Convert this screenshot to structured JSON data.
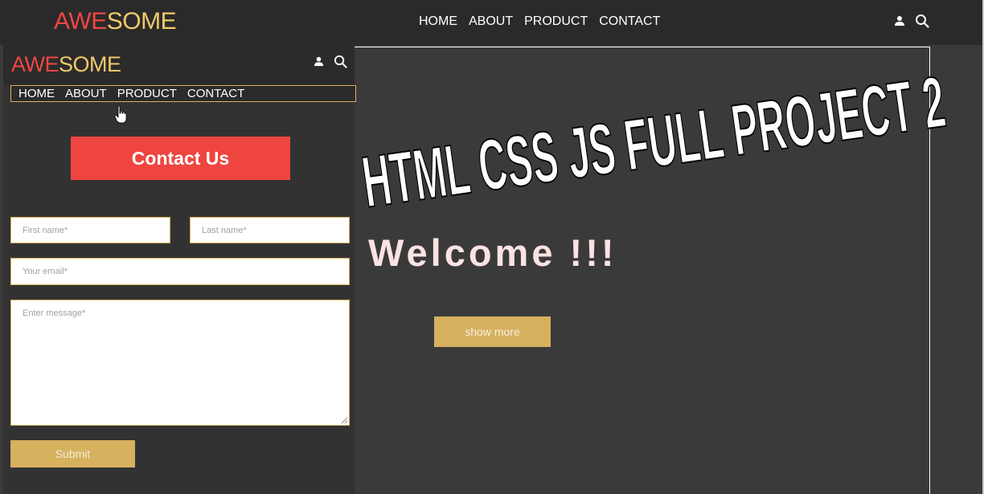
{
  "top_header": {
    "logo_part1": "AWE",
    "logo_part2": "SOME",
    "nav": [
      "HOME",
      "ABOUT",
      "PRODUCT",
      "CONTACT"
    ],
    "icons": [
      "user-icon",
      "search-icon"
    ]
  },
  "mobile_header": {
    "logo_part1": "AWE",
    "logo_part2": "SOME",
    "nav": [
      "HOME",
      "ABOUT",
      "PRODUCT",
      "CONTACT"
    ],
    "icons": [
      "user-icon",
      "search-icon"
    ]
  },
  "contact": {
    "title": "Contact Us",
    "first_name_placeholder": "First name*",
    "last_name_placeholder": "Last name*",
    "email_placeholder": "Your email*",
    "message_placeholder": "Enter message*",
    "submit_label": "Submit"
  },
  "hero": {
    "headline": "HTML CSS JS FULL PROJECT 2",
    "welcome": "Welcome !!!",
    "show_more_label": "show more"
  },
  "colors": {
    "logo_red": "#ef4641",
    "logo_gold": "#f2c96b",
    "accent_red": "#ee4540",
    "button_gold": "#d6b15e",
    "background": "#3b3a3b"
  }
}
